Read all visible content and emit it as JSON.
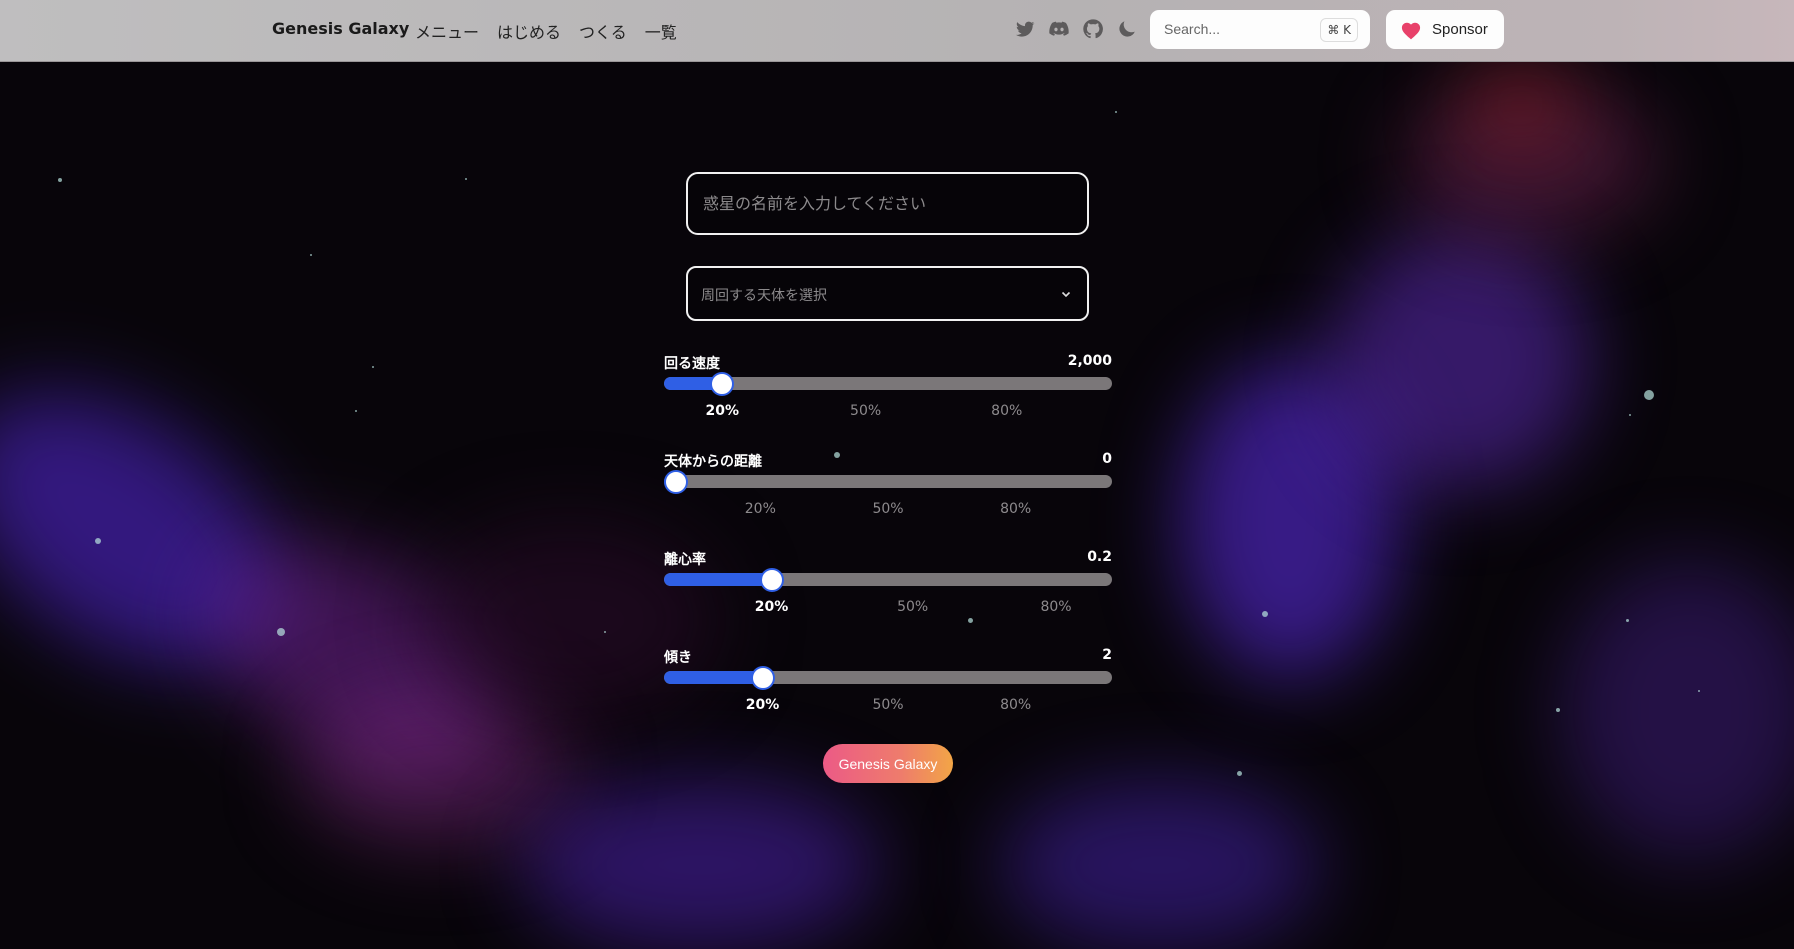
{
  "nav": {
    "brand": "Genesis Galaxy",
    "menu": [
      {
        "label": "メニュー"
      },
      {
        "label": "はじめる"
      },
      {
        "label": "つくる"
      },
      {
        "label": "一覧"
      }
    ],
    "icons": [
      "twitter-icon",
      "discord-icon",
      "github-icon",
      "moon-icon"
    ],
    "search": {
      "placeholder": "Search...",
      "shortcut": "⌘ K"
    },
    "sponsor": {
      "label": "Sponsor",
      "heart_color": "#e8416a"
    }
  },
  "form": {
    "planet_name": {
      "placeholder": "惑星の名前を入力してください",
      "value": ""
    },
    "orbit_body": {
      "placeholder": "周回する天体を選択"
    },
    "sliders": [
      {
        "label": "回る速度",
        "value": "2,000",
        "level": 0.13,
        "ticks": [
          "20%",
          "50%",
          "80%"
        ],
        "active_tick": 0
      },
      {
        "label": "天体からの距離",
        "value": "0",
        "level": 0.0,
        "ticks": [
          "20%",
          "50%",
          "80%"
        ],
        "active_tick": -1
      },
      {
        "label": "離心率",
        "value": "0.2",
        "level": 0.24,
        "ticks": [
          "20%",
          "50%",
          "80%"
        ],
        "active_tick": 0
      },
      {
        "label": "傾き",
        "value": "2",
        "level": 0.22,
        "ticks": [
          "20%",
          "50%",
          "80%"
        ],
        "active_tick": 0
      }
    ],
    "submit": {
      "label": "Genesis Galaxy"
    }
  },
  "colors": {
    "accent": "#2f5fe5",
    "button_from": "#ec5a86",
    "button_to": "#f2a546"
  }
}
